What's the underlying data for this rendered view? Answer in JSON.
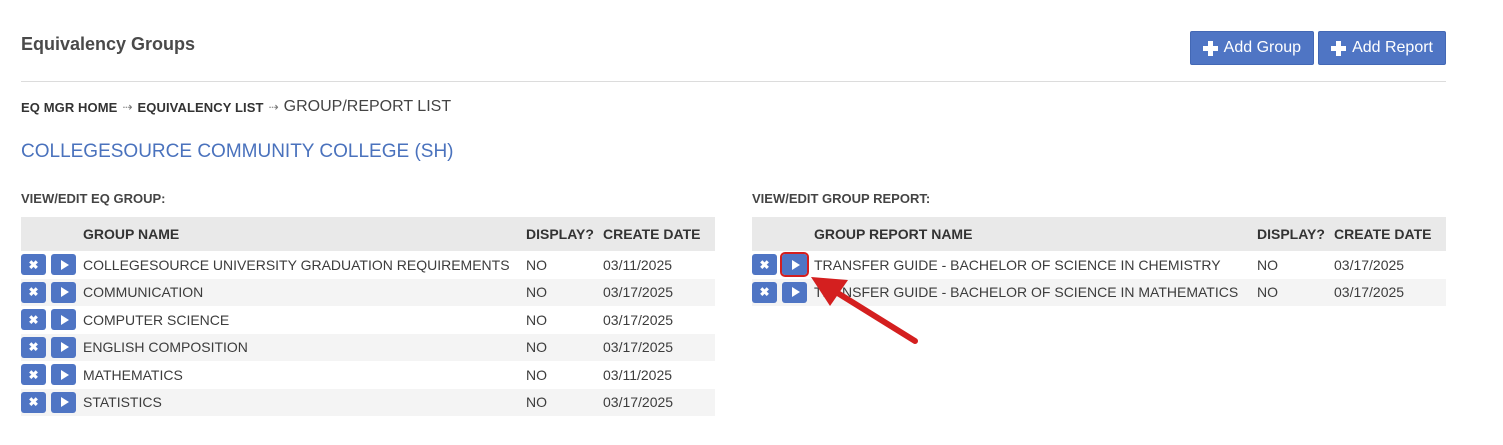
{
  "page": {
    "title": "Equivalency Groups",
    "add_group_label": "Add Group",
    "add_report_label": "Add Report"
  },
  "breadcrumb": {
    "home": "EQ MGR HOME",
    "sep": "⇢",
    "list": "EQUIVALENCY LIST",
    "current": "GROUP/REPORT LIST"
  },
  "college": "COLLEGESOURCE COMMUNITY COLLEGE (SH)",
  "groups": {
    "label": "VIEW/EDIT EQ GROUP:",
    "headers": {
      "name": "GROUP NAME",
      "display": "DISPLAY?",
      "date": "CREATE DATE"
    },
    "rows": [
      {
        "name": "COLLEGESOURCE UNIVERSITY GRADUATION REQUIREMENTS",
        "display": "NO",
        "date": "03/11/2025"
      },
      {
        "name": "COMMUNICATION",
        "display": "NO",
        "date": "03/17/2025"
      },
      {
        "name": "COMPUTER SCIENCE",
        "display": "NO",
        "date": "03/17/2025"
      },
      {
        "name": "ENGLISH COMPOSITION",
        "display": "NO",
        "date": "03/17/2025"
      },
      {
        "name": "MATHEMATICS",
        "display": "NO",
        "date": "03/11/2025"
      },
      {
        "name": "STATISTICS",
        "display": "NO",
        "date": "03/17/2025"
      }
    ]
  },
  "reports": {
    "label": "VIEW/EDIT GROUP REPORT:",
    "headers": {
      "name": "GROUP REPORT NAME",
      "display": "DISPLAY?",
      "date": "CREATE DATE"
    },
    "rows": [
      {
        "name": "TRANSFER GUIDE - BACHELOR OF SCIENCE IN CHEMISTRY",
        "display": "NO",
        "date": "03/17/2025"
      },
      {
        "name": "TRANSFER GUIDE - BACHELOR OF SCIENCE IN MATHEMATICS",
        "display": "NO",
        "date": "03/17/2025"
      }
    ]
  },
  "icons": {
    "delete": "close-icon",
    "view": "play-icon",
    "add": "plus-icon"
  },
  "colors": {
    "primary": "#4f75c4",
    "link": "#4a72bd",
    "annotation": "#d41f1f"
  }
}
